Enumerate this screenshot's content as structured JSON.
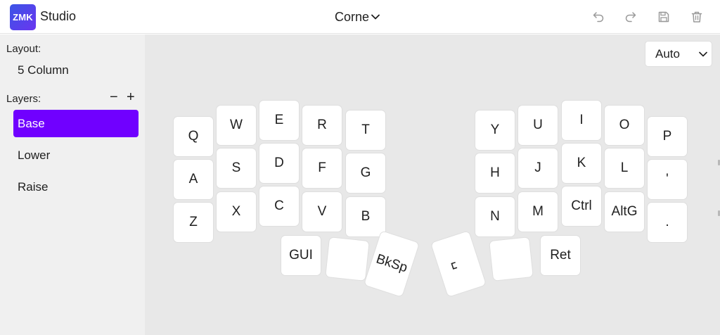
{
  "header": {
    "logo_text": "ZMK",
    "app_name": "Studio",
    "keyboard_name": "Corne",
    "icons": [
      "undo-icon",
      "redo-icon",
      "save-icon",
      "trash-icon"
    ]
  },
  "sidebar": {
    "layout_label": "Layout:",
    "layout_value": "5 Column",
    "layers_label": "Layers:",
    "remove_layer": "−",
    "add_layer": "+",
    "layers": [
      {
        "label": "Base",
        "active": true
      },
      {
        "label": "Lower",
        "active": false
      },
      {
        "label": "Raise",
        "active": false
      }
    ]
  },
  "main": {
    "layout_select": "Auto"
  },
  "keys": [
    {
      "label": "Q"
    },
    {
      "label": "W"
    },
    {
      "label": "E"
    },
    {
      "label": "R"
    },
    {
      "label": "T"
    },
    {
      "label": "A"
    },
    {
      "label": "S"
    },
    {
      "label": "D"
    },
    {
      "label": "F"
    },
    {
      "label": "G"
    },
    {
      "label": "Z"
    },
    {
      "label": "X"
    },
    {
      "label": "C"
    },
    {
      "label": "V"
    },
    {
      "label": "B"
    },
    {
      "label": "Y"
    },
    {
      "label": "U"
    },
    {
      "label": "I"
    },
    {
      "label": "O"
    },
    {
      "label": "P"
    },
    {
      "label": "H"
    },
    {
      "label": "J"
    },
    {
      "label": "K"
    },
    {
      "label": "L"
    },
    {
      "label": "'"
    },
    {
      "label": "N"
    },
    {
      "label": "M"
    },
    {
      "label": "Ctrl"
    },
    {
      "label": "AltG"
    },
    {
      "label": "."
    },
    {
      "label": "GUI"
    },
    {
      "label": ""
    },
    {
      "label": "BkSp"
    },
    {
      "label": "␣"
    },
    {
      "label": ""
    },
    {
      "label": "Ret"
    }
  ],
  "colors": {
    "accent": "#7000ff",
    "logo_gradient_start": "#3b55e6",
    "logo_gradient_end": "#6a35f0"
  }
}
